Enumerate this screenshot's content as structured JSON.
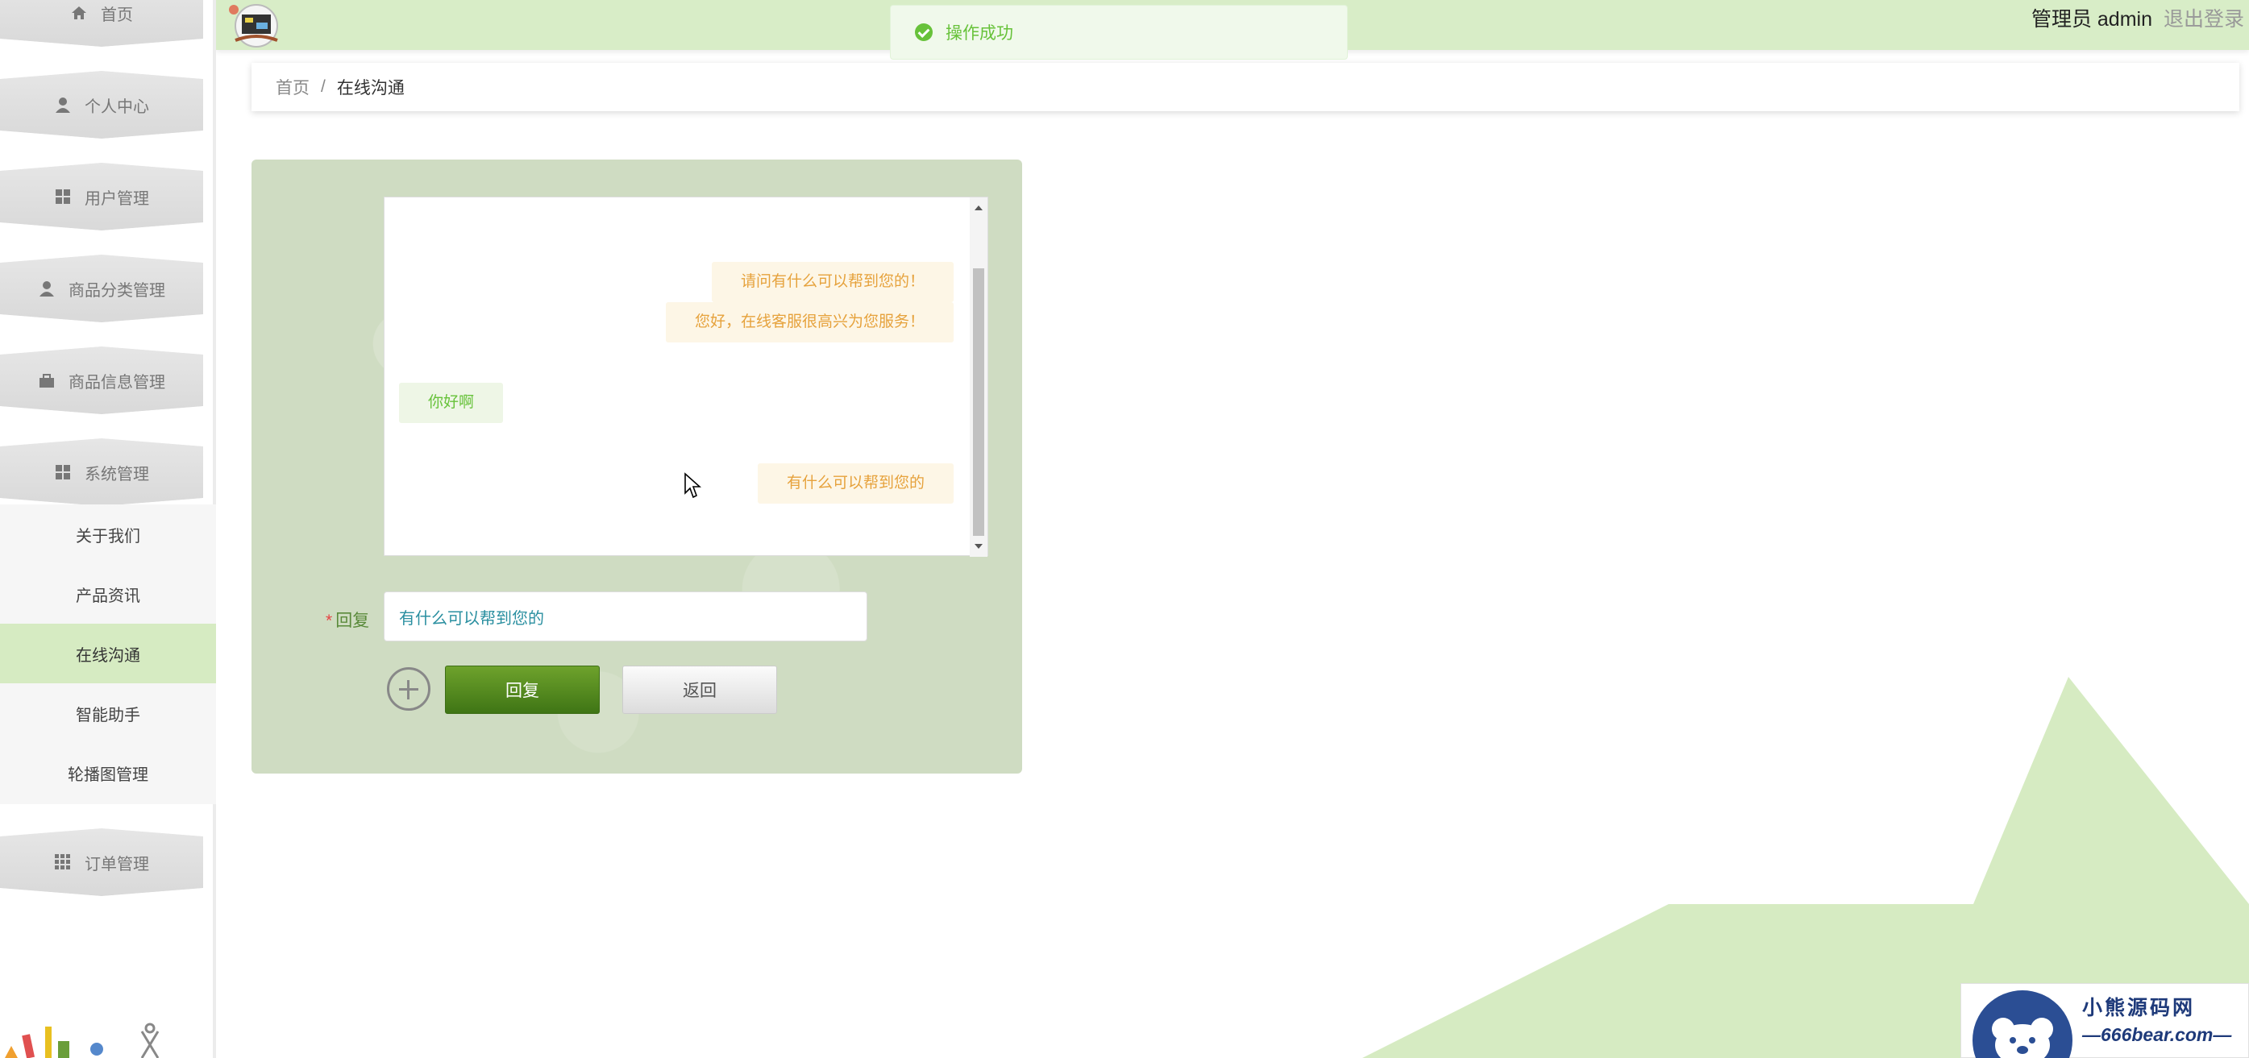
{
  "sidebar": {
    "items": [
      {
        "label": "首页",
        "icon": "home-icon"
      },
      {
        "label": "个人中心",
        "icon": "person-icon"
      },
      {
        "label": "用户管理",
        "icon": "grid-icon"
      },
      {
        "label": "商品分类管理",
        "icon": "person-icon"
      },
      {
        "label": "商品信息管理",
        "icon": "briefcase-icon"
      },
      {
        "label": "系统管理",
        "icon": "grid-icon"
      },
      {
        "label": "订单管理",
        "icon": "apps-icon"
      }
    ],
    "submenu": [
      {
        "label": "关于我们"
      },
      {
        "label": "产品资讯"
      },
      {
        "label": "在线沟通",
        "active": true
      },
      {
        "label": "智能助手"
      },
      {
        "label": "轮播图管理"
      }
    ]
  },
  "header": {
    "user": "管理员 admin",
    "logout": "退出登录"
  },
  "toast": {
    "message": "操作成功"
  },
  "breadcrumb": {
    "home": "首页",
    "separator": "/",
    "current": "在线沟通"
  },
  "chat": {
    "messages": [
      {
        "from": "service",
        "text": "请问有什么可以帮到您的！"
      },
      {
        "from": "service",
        "text": "您好，在线客服很高兴为您服务！"
      },
      {
        "from": "user",
        "text": "你好啊"
      },
      {
        "from": "service",
        "text": "有什么可以帮到您的"
      }
    ],
    "reply_label": "回复",
    "required_mark": "*",
    "reply_value": "有什么可以帮到您的",
    "reply_button": "回复",
    "back_button": "返回"
  },
  "watermark": {
    "name": "小熊源码网",
    "url": "—666bear.com—"
  },
  "colors": {
    "header_bg": "#d8edc7",
    "active_menu": "#d6ebc2",
    "reply_button": "#4f8a1e",
    "toast_green": "#67c23a",
    "service_msg": "#e6a23c"
  }
}
